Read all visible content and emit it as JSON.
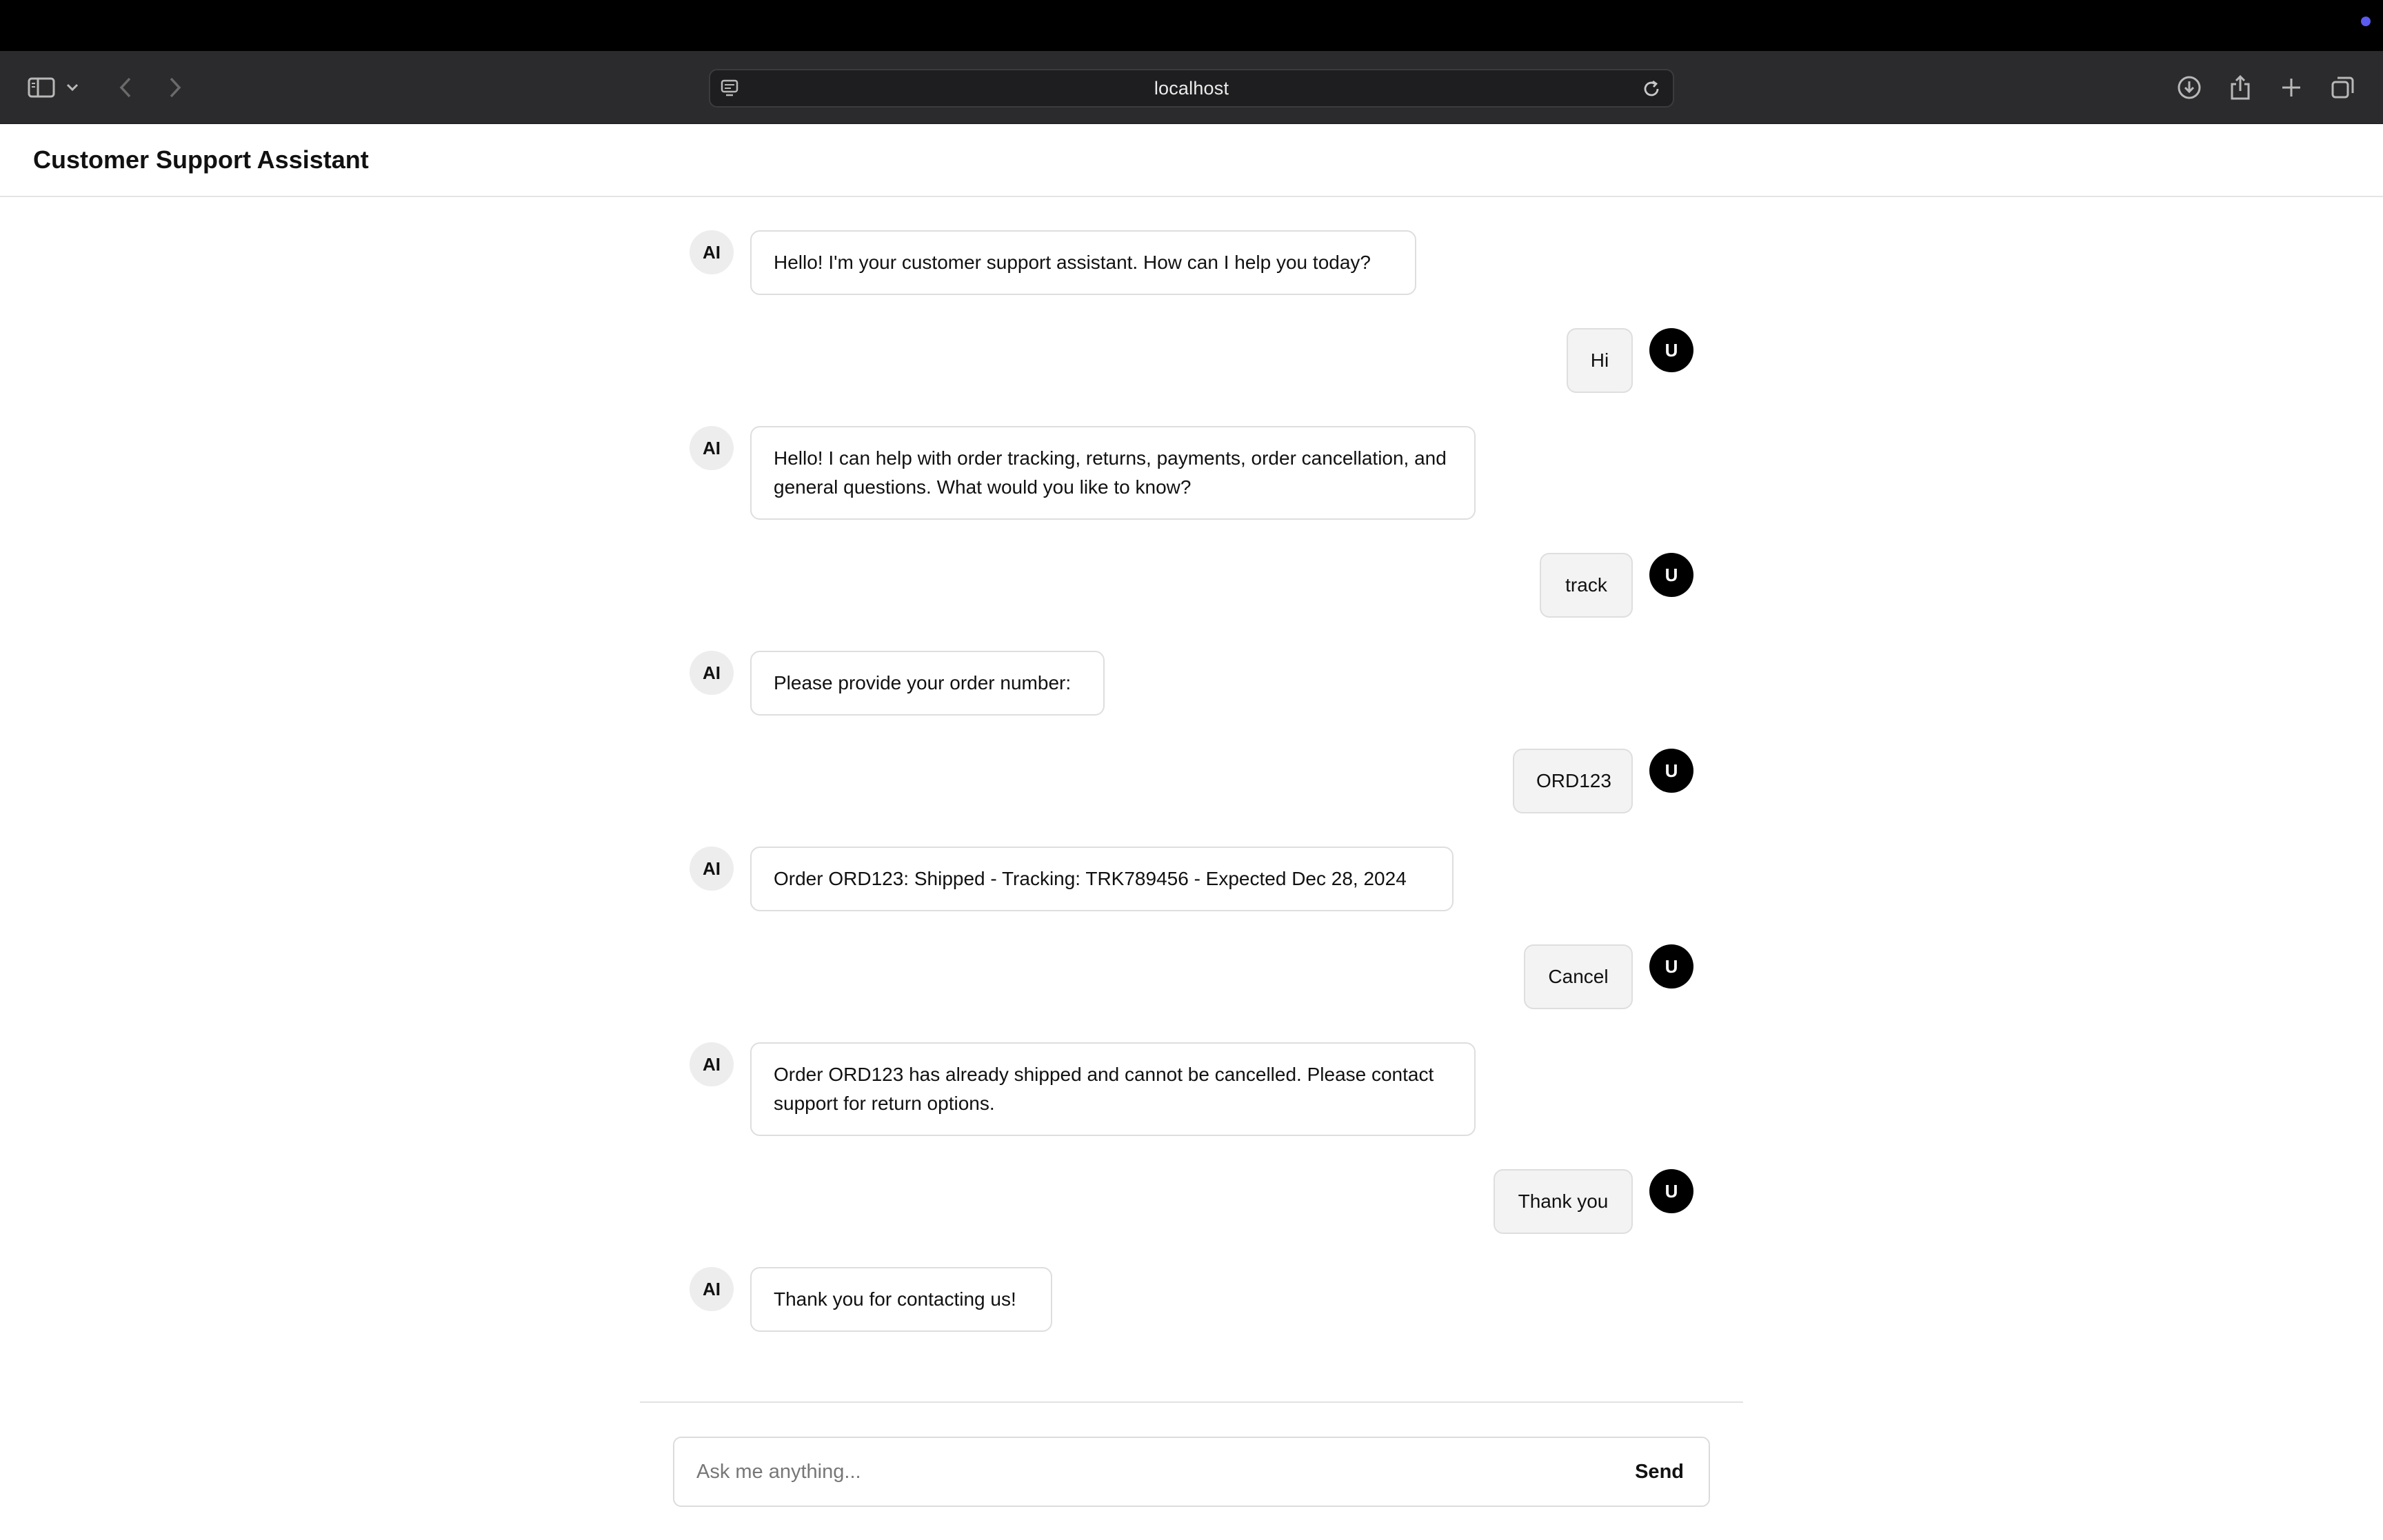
{
  "browser": {
    "url": "localhost",
    "icons": [
      "sidebar-icon",
      "chevron-down-icon",
      "back-icon",
      "forward-icon",
      "page-icon",
      "reload-icon",
      "download-icon",
      "share-icon",
      "new-tab-icon",
      "tabs-overview-icon"
    ]
  },
  "app": {
    "title": "Customer Support Assistant"
  },
  "chat": {
    "ai_label": "AI",
    "user_label": "U",
    "messages": [
      {
        "role": "ai",
        "text": "Hello! I'm your customer support assistant. How can I help you today?"
      },
      {
        "role": "user",
        "text": "Hi"
      },
      {
        "role": "ai",
        "text": "Hello! I can help with order tracking, returns, payments, order cancellation, and general questions. What would you like to know?"
      },
      {
        "role": "user",
        "text": "track"
      },
      {
        "role": "ai",
        "text": "Please provide your order number:"
      },
      {
        "role": "user",
        "text": "ORD123"
      },
      {
        "role": "ai",
        "text": "Order ORD123: Shipped - Tracking: TRK789456 - Expected Dec 28, 2024"
      },
      {
        "role": "user",
        "text": "Cancel"
      },
      {
        "role": "ai",
        "text": "Order ORD123 has already shipped and cannot be cancelled. Please contact support for return options."
      },
      {
        "role": "user",
        "text": "Thank you"
      },
      {
        "role": "ai",
        "text": "Thank you for contacting us!"
      }
    ]
  },
  "composer": {
    "placeholder": "Ask me anything...",
    "value": "",
    "send_label": "Send"
  }
}
